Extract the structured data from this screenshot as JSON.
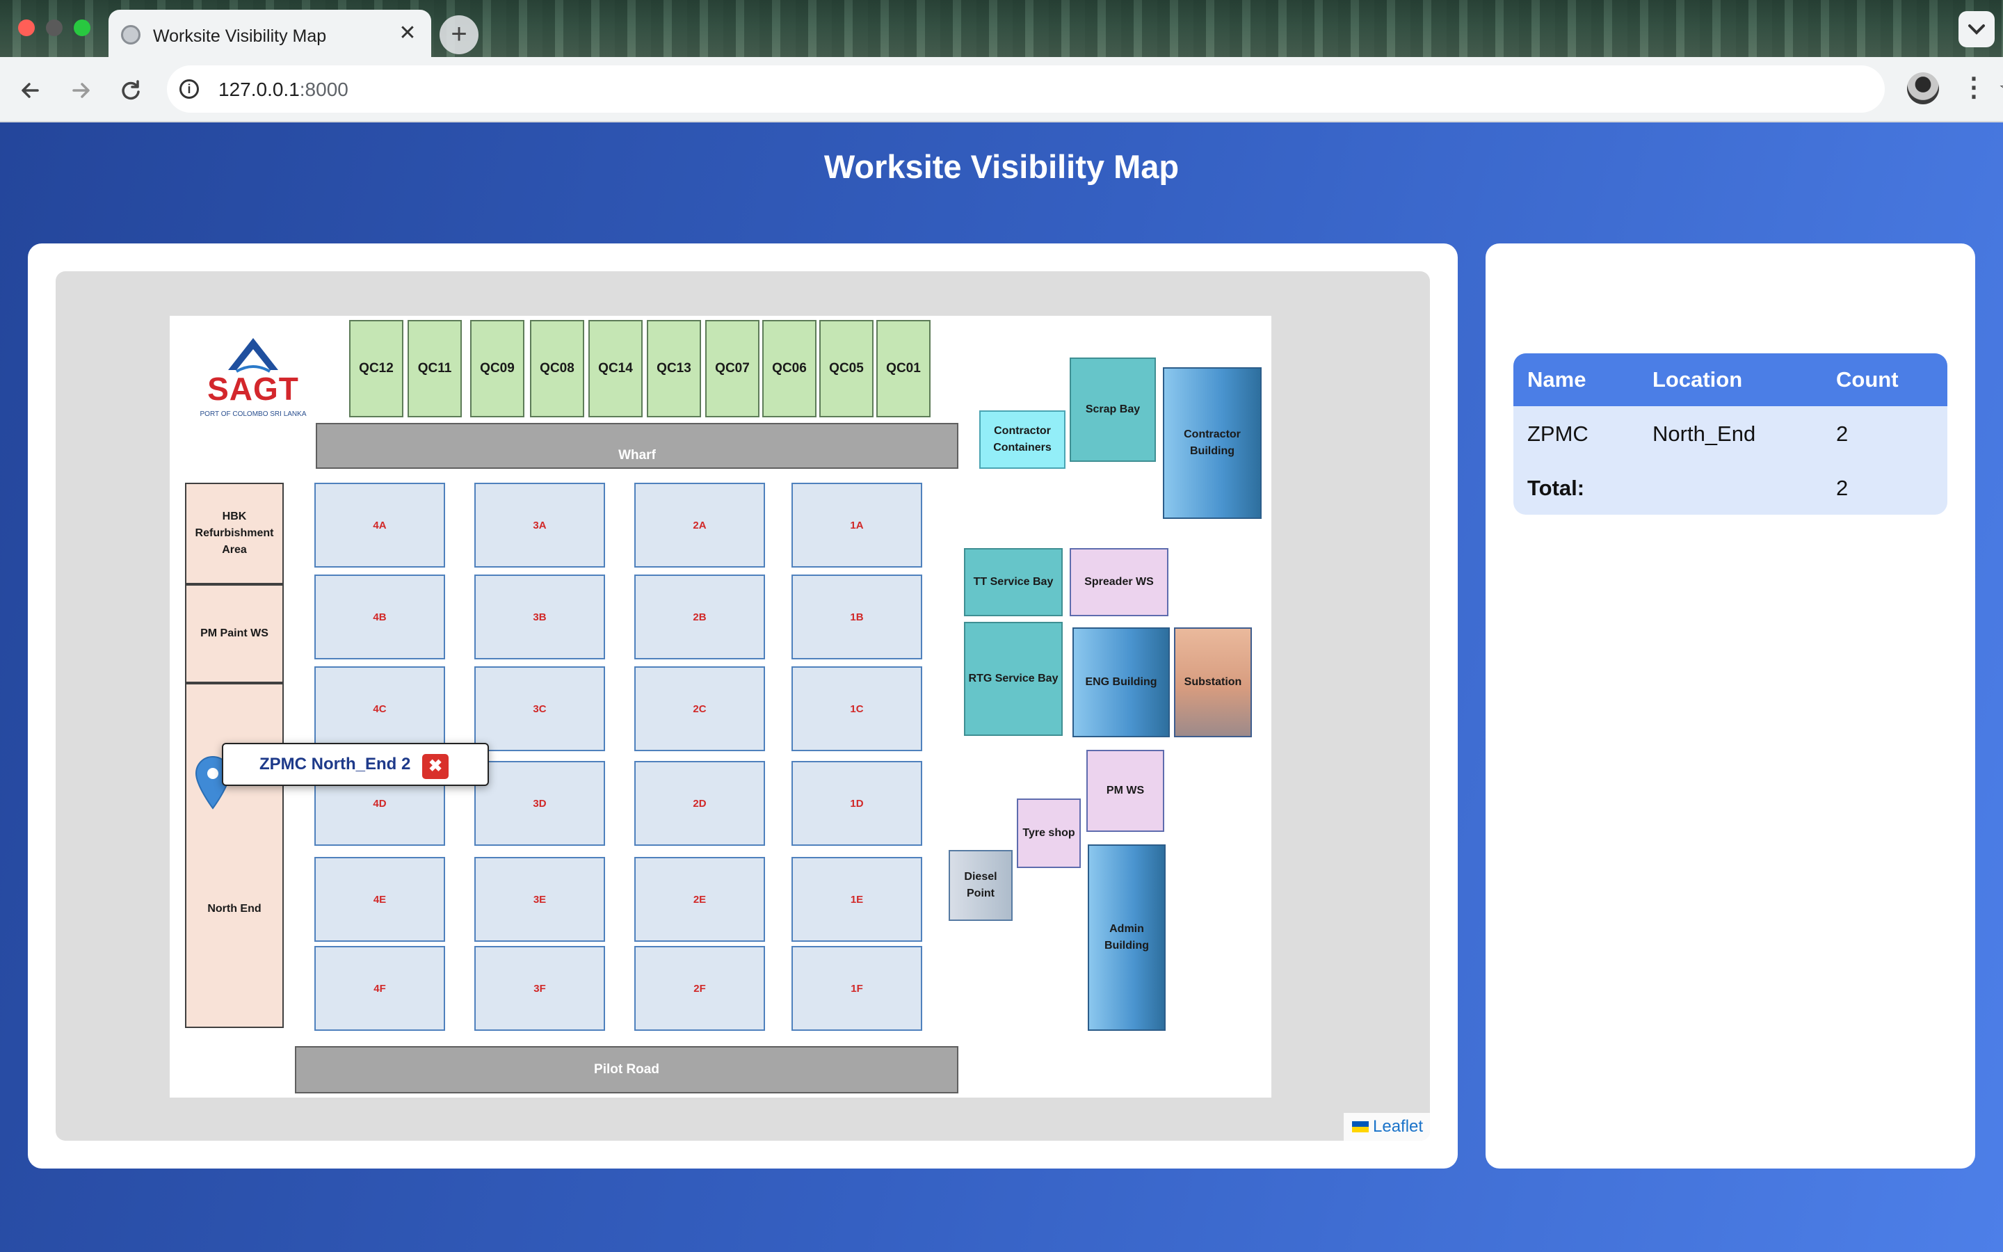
{
  "browser": {
    "tab_title": "Worksite Visibility Map",
    "tab_close": "✕",
    "new_tab": "+",
    "url_host": "127.0.0.1",
    "url_port": ":8000",
    "icons": [
      "globe-icon",
      "close-icon",
      "back-icon",
      "forward-icon",
      "reload-icon",
      "info-icon",
      "star-icon",
      "avatar",
      "kebab-menu-icon",
      "chevron-down-icon"
    ]
  },
  "page": {
    "title": "Worksite Visibility Map"
  },
  "map": {
    "logo_text": "SAGT",
    "logo_sub": "PORT OF COLOMBO SRI LANKA",
    "quay_cranes": [
      "QC12",
      "QC11",
      "QC09",
      "QC08",
      "QC14",
      "QC13",
      "QC07",
      "QC06",
      "QC05",
      "QC01"
    ],
    "wharf": "Wharf",
    "pilot_road": "Pilot Road",
    "bays": {
      "col4": [
        "4A",
        "4B",
        "4C",
        "4D",
        "4E",
        "4F"
      ],
      "col3": [
        "3A",
        "3B",
        "3C",
        "3D",
        "3E",
        "3F"
      ],
      "col2": [
        "2A",
        "2B",
        "2C",
        "2D",
        "2E",
        "2F"
      ],
      "col1": [
        "1A",
        "1B",
        "1C",
        "1D",
        "1E",
        "1F"
      ]
    },
    "areas": {
      "hbk": "HBK Refurbishment Area",
      "pm_paint": "PM Paint WS",
      "north_end": "North End",
      "contractor_containers": "Contractor Containers",
      "scrap_bay": "Scrap Bay",
      "contractor_building": "Contractor Building",
      "tt_service_bay": "TT Service Bay",
      "spreader_ws": "Spreader WS",
      "rtg_service_bay": "RTG Service Bay",
      "eng_building": "ENG Building",
      "substation": "Substation",
      "pm_ws": "PM WS",
      "tyre_shop": "Tyre shop",
      "diesel_point": "Diesel Point",
      "admin_building": "Admin Building"
    },
    "popup": {
      "text": "ZPMC North_End 2",
      "close": "✖"
    },
    "attribution": "Leaflet"
  },
  "summary": {
    "headers": [
      "Name",
      "Location",
      "Count"
    ],
    "rows": [
      {
        "name": "ZPMC",
        "location": "North_End",
        "count": "2"
      }
    ],
    "total_label": "Total:",
    "total_value": "2"
  },
  "colors": {
    "header_blue": "#4b7ee6",
    "qc_green": "#c5e6b4",
    "bay_fill": "#dce6f2",
    "bay_label_red": "#d12828",
    "popup_close_red": "#d9312b"
  }
}
